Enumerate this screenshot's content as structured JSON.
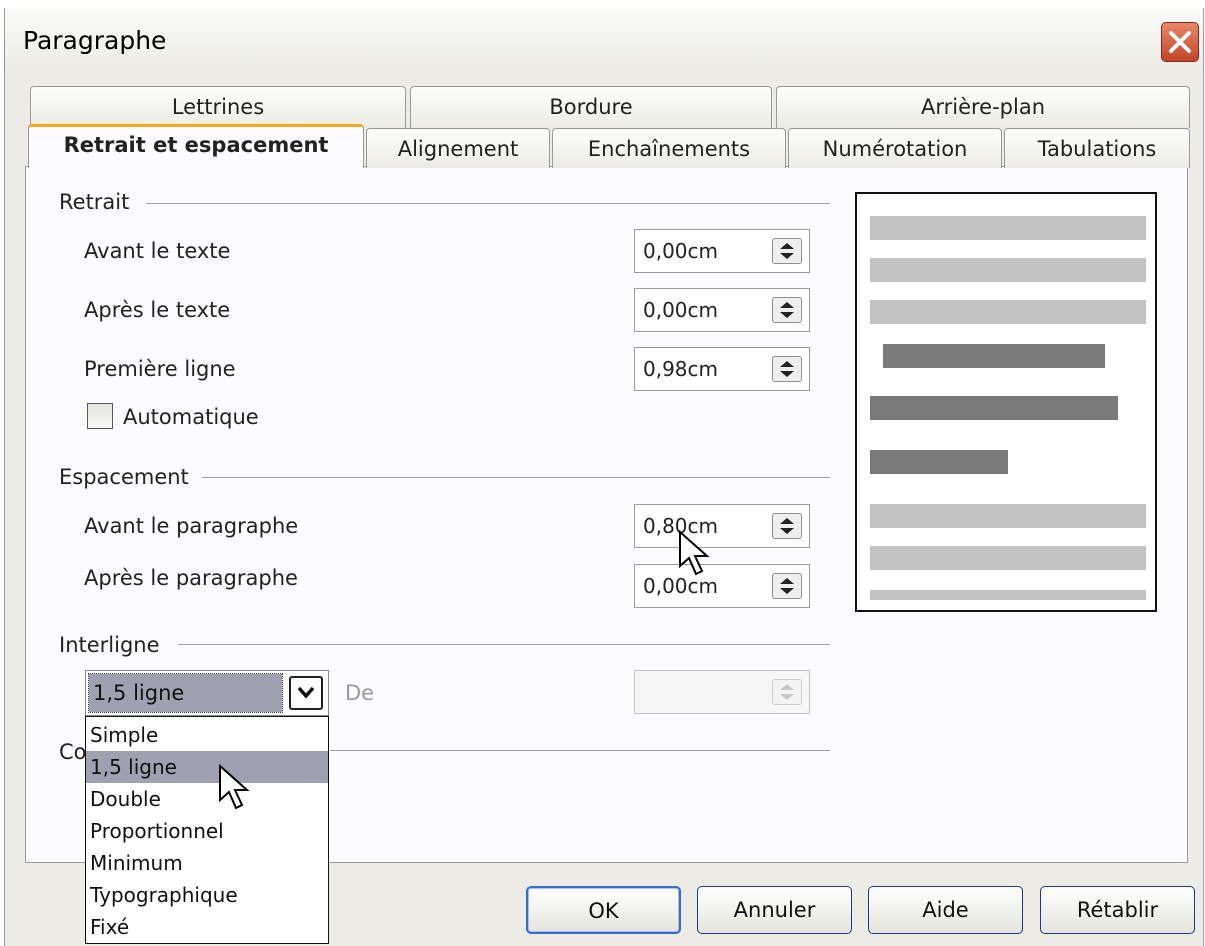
{
  "window": {
    "title": "Paragraphe"
  },
  "tabs": {
    "row1": [
      "Lettrines",
      "Bordure",
      "Arrière-plan"
    ],
    "row2": [
      "Retrait et espacement",
      "Alignement",
      "Enchaînements",
      "Numérotation",
      "Tabulations"
    ],
    "active": "Retrait et espacement"
  },
  "retrait": {
    "title": "Retrait",
    "avant_label": "Avant le texte",
    "avant_value": "0,00cm",
    "apres_label": "Après le texte",
    "apres_value": "0,00cm",
    "premiere_label": "Première ligne",
    "premiere_value": "0,98cm",
    "automatique_label": "Automatique",
    "automatique_checked": false
  },
  "espacement": {
    "title": "Espacement",
    "avant_label": "Avant le paragraphe",
    "avant_value": "0,80cm",
    "apres_label": "Après le paragraphe",
    "apres_value": "0,00cm"
  },
  "interligne": {
    "title": "Interligne",
    "selected": "1,5 ligne",
    "de_label": "De",
    "de_value": "",
    "options": [
      "Simple",
      "1,5 ligne",
      "Double",
      "Proportionnel",
      "Minimum",
      "Typographique",
      "Fixé"
    ]
  },
  "hidden_section_partial": "Co",
  "buttons": {
    "ok": "OK",
    "cancel": "Annuler",
    "help": "Aide",
    "reset": "Rétablir"
  },
  "colors": {
    "selection": "#9fa0b0",
    "active_tab_accent": "#f5a623",
    "close_button": "#c4432a"
  }
}
